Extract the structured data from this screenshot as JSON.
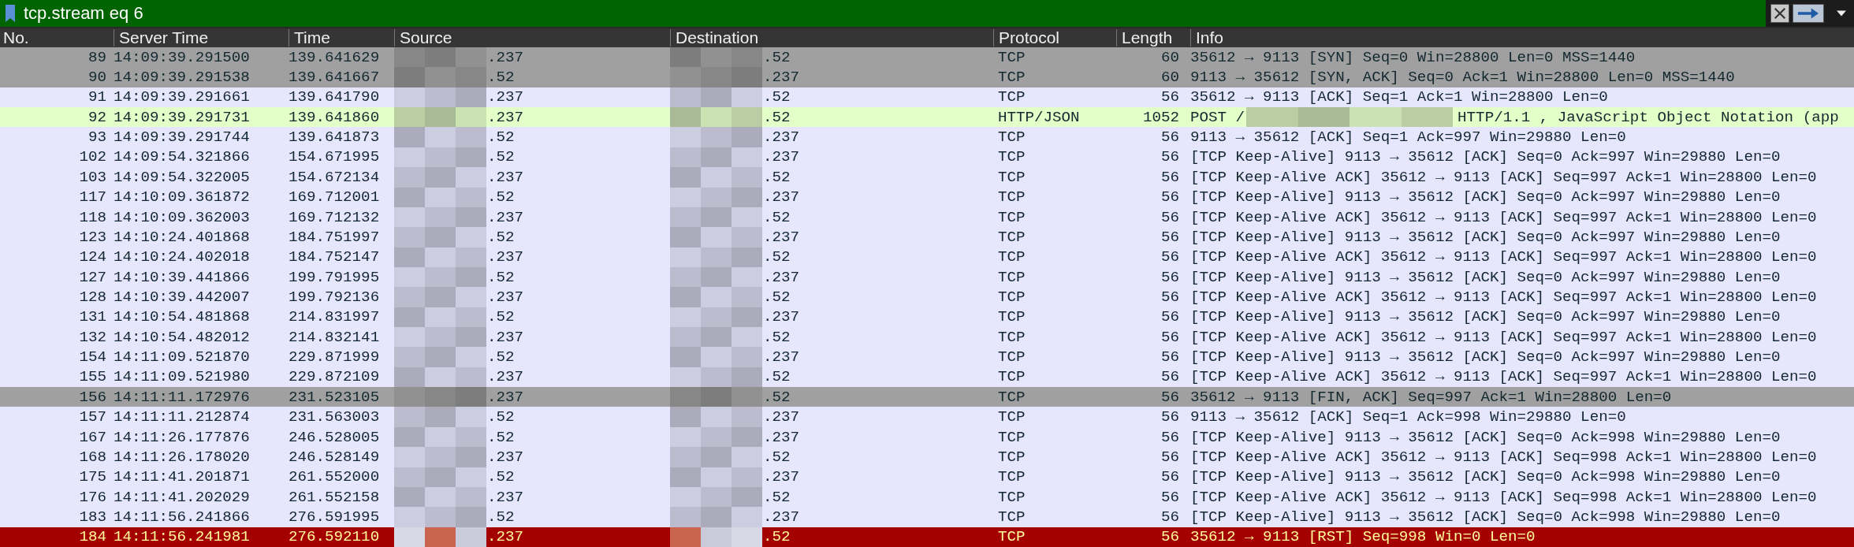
{
  "filter": {
    "value": "tcp.stream eq 6"
  },
  "columns": [
    "No.",
    "Server Time",
    "Time",
    "Source",
    "Destination",
    "Protocol",
    "Length",
    "Info"
  ],
  "rows": [
    {
      "no": "89",
      "server_time": "14:09:39.291500",
      "time": "139.641629",
      "source": ".237",
      "destination": ".52",
      "protocol": "TCP",
      "length": "60",
      "info": "35612 → 9113 [SYN] Seq=0 Win=28800 Len=0 MSS=1440",
      "color": "#a0a0a0"
    },
    {
      "no": "90",
      "server_time": "14:09:39.291538",
      "time": "139.641667",
      "source": ".52",
      "destination": ".237",
      "protocol": "TCP",
      "length": "60",
      "info": "9113 → 35612 [SYN, ACK] Seq=0 Ack=1 Win=28800 Len=0 MSS=1440",
      "color": "#a0a0a0"
    },
    {
      "no": "91",
      "server_time": "14:09:39.291661",
      "time": "139.641790",
      "source": ".237",
      "destination": ".52",
      "protocol": "TCP",
      "length": "56",
      "info": "35612 → 9113 [ACK] Seq=1 Ack=1 Win=28800 Len=0",
      "color": "#e7e6ff"
    },
    {
      "no": "92",
      "server_time": "14:09:39.291731",
      "time": "139.641860",
      "source": ".237",
      "destination": ".52",
      "protocol": "HTTP/JSON",
      "length": "1052",
      "info": "POST /",
      "info_after_redaction": "HTTP/1.1 , JavaScript Object Notation (app",
      "color": "#e4ffc7"
    },
    {
      "no": "93",
      "server_time": "14:09:39.291744",
      "time": "139.641873",
      "source": ".52",
      "destination": ".237",
      "protocol": "TCP",
      "length": "56",
      "info": "9113 → 35612 [ACK] Seq=1 Ack=997 Win=29880 Len=0",
      "color": "#e7e6ff"
    },
    {
      "no": "102",
      "server_time": "14:09:54.321866",
      "time": "154.671995",
      "source": ".52",
      "destination": ".237",
      "protocol": "TCP",
      "length": "56",
      "info": "[TCP Keep-Alive] 9113 → 35612 [ACK] Seq=0 Ack=997 Win=29880 Len=0",
      "color": "#e7e6ff"
    },
    {
      "no": "103",
      "server_time": "14:09:54.322005",
      "time": "154.672134",
      "source": ".237",
      "destination": ".52",
      "protocol": "TCP",
      "length": "56",
      "info": "[TCP Keep-Alive ACK] 35612 → 9113 [ACK] Seq=997 Ack=1 Win=28800 Len=0",
      "color": "#e7e6ff"
    },
    {
      "no": "117",
      "server_time": "14:10:09.361872",
      "time": "169.712001",
      "source": ".52",
      "destination": ".237",
      "protocol": "TCP",
      "length": "56",
      "info": "[TCP Keep-Alive] 9113 → 35612 [ACK] Seq=0 Ack=997 Win=29880 Len=0",
      "color": "#e7e6ff"
    },
    {
      "no": "118",
      "server_time": "14:10:09.362003",
      "time": "169.712132",
      "source": ".237",
      "destination": ".52",
      "protocol": "TCP",
      "length": "56",
      "info": "[TCP Keep-Alive ACK] 35612 → 9113 [ACK] Seq=997 Ack=1 Win=28800 Len=0",
      "color": "#e7e6ff"
    },
    {
      "no": "123",
      "server_time": "14:10:24.401868",
      "time": "184.751997",
      "source": ".52",
      "destination": ".237",
      "protocol": "TCP",
      "length": "56",
      "info": "[TCP Keep-Alive] 9113 → 35612 [ACK] Seq=0 Ack=997 Win=29880 Len=0",
      "color": "#e7e6ff"
    },
    {
      "no": "124",
      "server_time": "14:10:24.402018",
      "time": "184.752147",
      "source": ".237",
      "destination": ".52",
      "protocol": "TCP",
      "length": "56",
      "info": "[TCP Keep-Alive ACK] 35612 → 9113 [ACK] Seq=997 Ack=1 Win=28800 Len=0",
      "color": "#e7e6ff"
    },
    {
      "no": "127",
      "server_time": "14:10:39.441866",
      "time": "199.791995",
      "source": ".52",
      "destination": ".237",
      "protocol": "TCP",
      "length": "56",
      "info": "[TCP Keep-Alive] 9113 → 35612 [ACK] Seq=0 Ack=997 Win=29880 Len=0",
      "color": "#e7e6ff"
    },
    {
      "no": "128",
      "server_time": "14:10:39.442007",
      "time": "199.792136",
      "source": ".237",
      "destination": ".52",
      "protocol": "TCP",
      "length": "56",
      "info": "[TCP Keep-Alive ACK] 35612 → 9113 [ACK] Seq=997 Ack=1 Win=28800 Len=0",
      "color": "#e7e6ff"
    },
    {
      "no": "131",
      "server_time": "14:10:54.481868",
      "time": "214.831997",
      "source": ".52",
      "destination": ".237",
      "protocol": "TCP",
      "length": "56",
      "info": "[TCP Keep-Alive] 9113 → 35612 [ACK] Seq=0 Ack=997 Win=29880 Len=0",
      "color": "#e7e6ff"
    },
    {
      "no": "132",
      "server_time": "14:10:54.482012",
      "time": "214.832141",
      "source": ".237",
      "destination": ".52",
      "protocol": "TCP",
      "length": "56",
      "info": "[TCP Keep-Alive ACK] 35612 → 9113 [ACK] Seq=997 Ack=1 Win=28800 Len=0",
      "color": "#e7e6ff"
    },
    {
      "no": "154",
      "server_time": "14:11:09.521870",
      "time": "229.871999",
      "source": ".52",
      "destination": ".237",
      "protocol": "TCP",
      "length": "56",
      "info": "[TCP Keep-Alive] 9113 → 35612 [ACK] Seq=0 Ack=997 Win=29880 Len=0",
      "color": "#e7e6ff"
    },
    {
      "no": "155",
      "server_time": "14:11:09.521980",
      "time": "229.872109",
      "source": ".237",
      "destination": ".52",
      "protocol": "TCP",
      "length": "56",
      "info": "[TCP Keep-Alive ACK] 35612 → 9113 [ACK] Seq=997 Ack=1 Win=28800 Len=0",
      "color": "#e7e6ff"
    },
    {
      "no": "156",
      "server_time": "14:11:11.172976",
      "time": "231.523105",
      "source": ".237",
      "destination": ".52",
      "protocol": "TCP",
      "length": "56",
      "info": "35612 → 9113 [FIN, ACK] Seq=997 Ack=1 Win=28800 Len=0",
      "color": "#a0a0a0"
    },
    {
      "no": "157",
      "server_time": "14:11:11.212874",
      "time": "231.563003",
      "source": ".52",
      "destination": ".237",
      "protocol": "TCP",
      "length": "56",
      "info": "9113 → 35612 [ACK] Seq=1 Ack=998 Win=29880 Len=0",
      "color": "#e7e6ff"
    },
    {
      "no": "167",
      "server_time": "14:11:26.177876",
      "time": "246.528005",
      "source": ".52",
      "destination": ".237",
      "protocol": "TCP",
      "length": "56",
      "info": "[TCP Keep-Alive] 9113 → 35612 [ACK] Seq=0 Ack=998 Win=29880 Len=0",
      "color": "#e7e6ff"
    },
    {
      "no": "168",
      "server_time": "14:11:26.178020",
      "time": "246.528149",
      "source": ".237",
      "destination": ".52",
      "protocol": "TCP",
      "length": "56",
      "info": "[TCP Keep-Alive ACK] 35612 → 9113 [ACK] Seq=998 Ack=1 Win=28800 Len=0",
      "color": "#e7e6ff"
    },
    {
      "no": "175",
      "server_time": "14:11:41.201871",
      "time": "261.552000",
      "source": ".52",
      "destination": ".237",
      "protocol": "TCP",
      "length": "56",
      "info": "[TCP Keep-Alive] 9113 → 35612 [ACK] Seq=0 Ack=998 Win=29880 Len=0",
      "color": "#e7e6ff"
    },
    {
      "no": "176",
      "server_time": "14:11:41.202029",
      "time": "261.552158",
      "source": ".237",
      "destination": ".52",
      "protocol": "TCP",
      "length": "56",
      "info": "[TCP Keep-Alive ACK] 35612 → 9113 [ACK] Seq=998 Ack=1 Win=28800 Len=0",
      "color": "#e7e6ff"
    },
    {
      "no": "183",
      "server_time": "14:11:56.241866",
      "time": "276.591995",
      "source": ".52",
      "destination": ".237",
      "protocol": "TCP",
      "length": "56",
      "info": "[TCP Keep-Alive] 9113 → 35612 [ACK] Seq=0 Ack=998 Win=29880 Len=0",
      "color": "#e7e6ff"
    },
    {
      "no": "184",
      "server_time": "14:11:56.241981",
      "time": "276.592110",
      "source": ".237",
      "destination": ".52",
      "protocol": "TCP",
      "length": "56",
      "info": "35612 → 9113 [RST] Seq=998 Win=0 Len=0",
      "color": "#a40000"
    }
  ]
}
